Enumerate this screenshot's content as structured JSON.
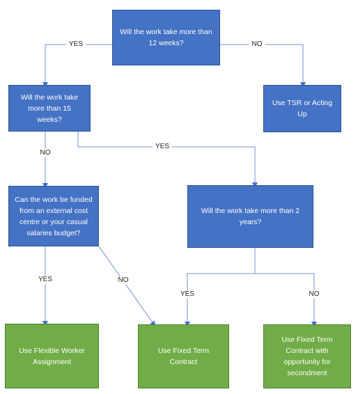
{
  "nodes": {
    "q12weeks": "Will the work take more than 12 weeks?",
    "q15weeks": "Will the work take more than 15 weeks?",
    "tsr": "Use TSR or Acting Up",
    "qfunded": "Can the work be funded from an external cost centre or your casual salaries budget?",
    "q2years": "Will the work take more than 2 years?",
    "flexible": "Use Flexible Worker Assignment",
    "fixed": "Use Fixed Term Contract",
    "fixedSecond": "Use Fixed Term Contract with opportunity for secondment"
  },
  "labels": {
    "q12_yes": "YES",
    "q12_no": "NO",
    "q15_no": "NO",
    "q15_yes": "YES",
    "funded_yes": "YES",
    "funded_no": "NO",
    "y2_yes": "YES",
    "y2_no": "NO"
  },
  "colors": {
    "decision": "#4472c4",
    "outcome": "#70ad47",
    "line": "#8eaadb"
  }
}
